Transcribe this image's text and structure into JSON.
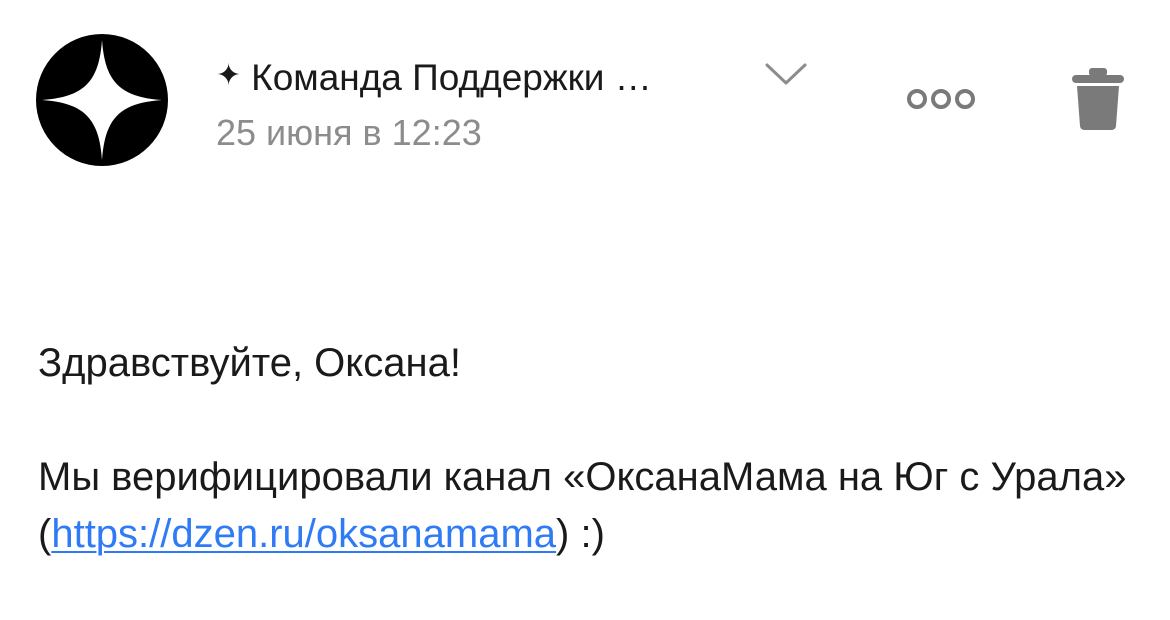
{
  "header": {
    "avatar_icon": "yandex-zen-star-icon",
    "sender_prefix_icon": "sparkle-icon",
    "sender_star": "✦",
    "sender_name": "Команда Поддержки …",
    "expand_icon": "chevron-down-icon",
    "date": "25 июня в 12:23",
    "more_icon": "more-dots-icon",
    "delete_icon": "trash-icon"
  },
  "message": {
    "greeting": "Здравствуйте, Оксана!",
    "line_before_link": "Мы верифицировали канал «ОксанаМама на Юг с Урала» (",
    "link_text": "https://dzen.ru/oksanamama",
    "line_after_link": ") :)"
  },
  "colors": {
    "link": "#2f7bf5",
    "date_gray": "#8c8c8c",
    "icon_gray": "#7a7a7a"
  }
}
